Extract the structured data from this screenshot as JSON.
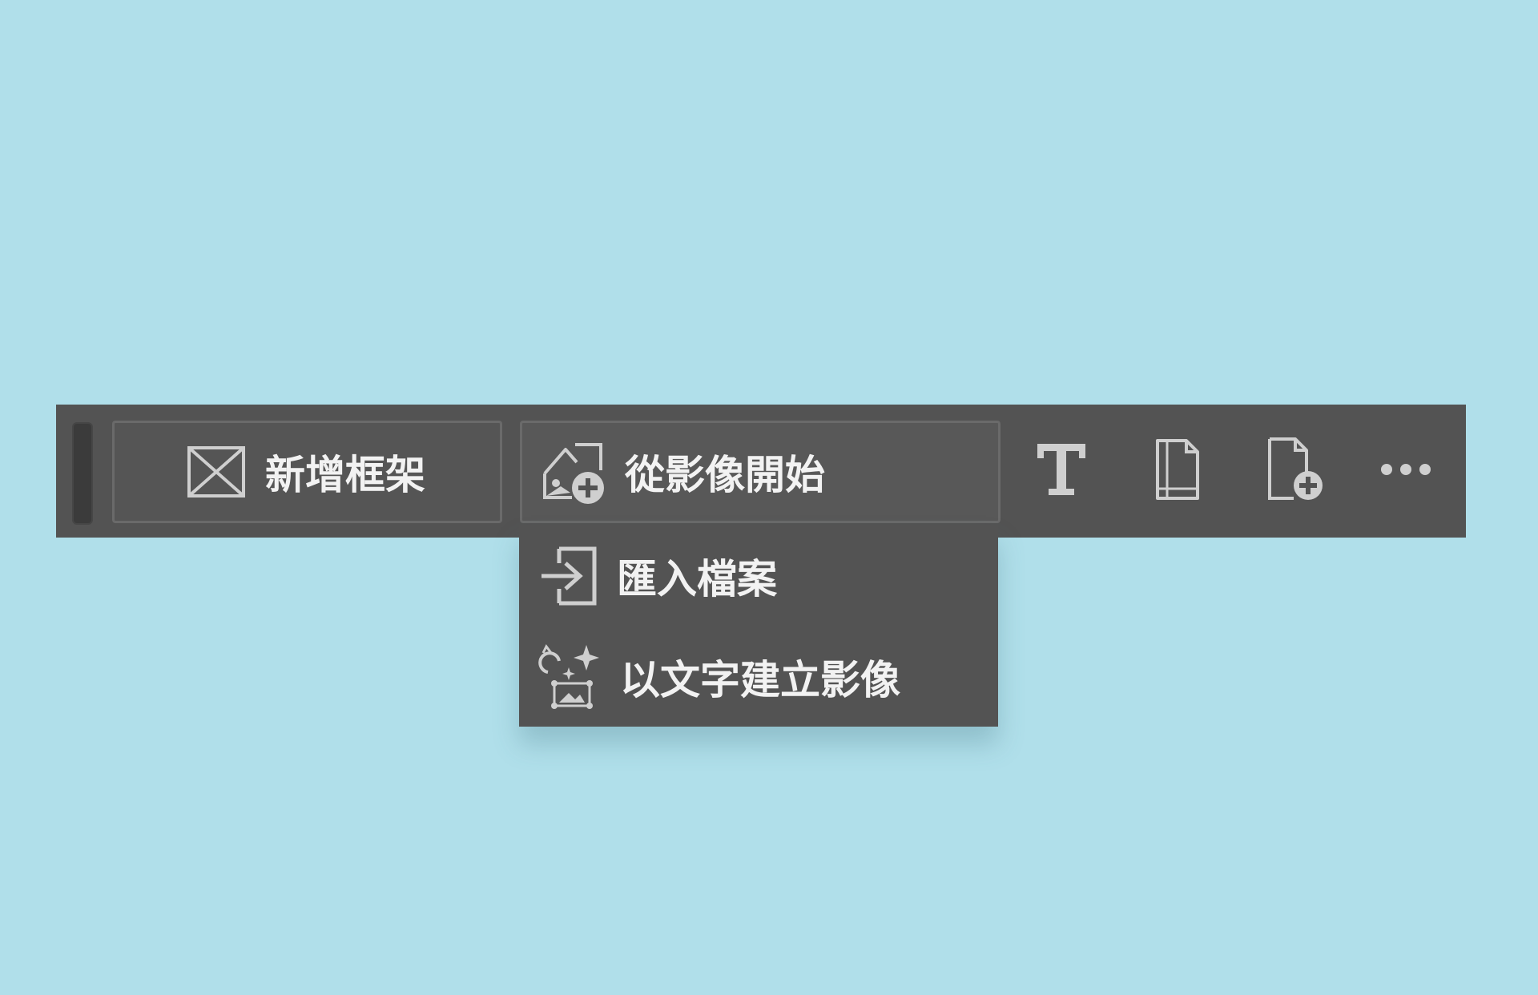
{
  "toolbar": {
    "new_frame_label": "新增框架",
    "start_from_image_label": "從影像開始",
    "icons": {
      "frame": "frame-placeholder-icon",
      "image_add": "image-add-icon",
      "text": "text-tool-icon",
      "page": "page-icon",
      "add_page": "add-page-icon",
      "more": "more-options-icon"
    }
  },
  "dropdown": {
    "items": [
      {
        "label": "匯入檔案",
        "icon": "import-file-icon"
      },
      {
        "label": "以文字建立影像",
        "icon": "text-to-image-icon"
      }
    ]
  },
  "colors": {
    "background": "#b0dfea",
    "toolbar": "#535353",
    "text": "#f2f2f2",
    "icon": "#cfcfcf"
  }
}
